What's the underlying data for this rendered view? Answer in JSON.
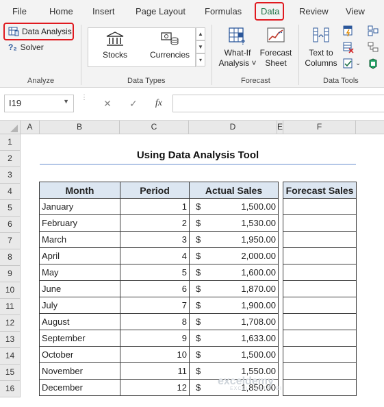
{
  "tabs": [
    "File",
    "Home",
    "Insert",
    "Page Layout",
    "Formulas",
    "Data",
    "Review",
    "View"
  ],
  "active_tab": "Data",
  "highlight_color": "#e0191f",
  "ribbon": {
    "analyze": {
      "data_analysis": "Data Analysis",
      "solver": "Solver",
      "label": "Analyze"
    },
    "data_types": {
      "stocks": "Stocks",
      "currencies": "Currencies",
      "label": "Data Types"
    },
    "forecast": {
      "what_if_1": "What-If",
      "what_if_2": "Analysis ˅",
      "sheet_1": "Forecast",
      "sheet_2": "Sheet",
      "label": "Forecast"
    },
    "data_tools": {
      "ttc_1": "Text to",
      "ttc_2": "Columns",
      "label": "Data Tools"
    }
  },
  "formula_bar": {
    "name_box": "I19",
    "cancel": "✕",
    "enter": "✓",
    "fx": "fx",
    "value": ""
  },
  "columns": [
    "A",
    "B",
    "C",
    "D",
    "E",
    "F"
  ],
  "rows": [
    "1",
    "2",
    "3",
    "4",
    "5",
    "6",
    "7",
    "8",
    "9",
    "10",
    "11",
    "12",
    "13",
    "14",
    "15",
    "16"
  ],
  "title": "Using Data Analysis Tool",
  "table": {
    "headers": [
      "Month",
      "Period",
      "Actual Sales"
    ],
    "rows": [
      {
        "month": "January",
        "period": "1",
        "sales": "1,500.00"
      },
      {
        "month": "February",
        "period": "2",
        "sales": "1,530.00"
      },
      {
        "month": "March",
        "period": "3",
        "sales": "1,950.00"
      },
      {
        "month": "April",
        "period": "4",
        "sales": "2,000.00"
      },
      {
        "month": "May",
        "period": "5",
        "sales": "1,600.00"
      },
      {
        "month": "June",
        "period": "6",
        "sales": "1,870.00"
      },
      {
        "month": "July",
        "period": "7",
        "sales": "1,900.00"
      },
      {
        "month": "August",
        "period": "8",
        "sales": "1,708.00"
      },
      {
        "month": "September",
        "period": "9",
        "sales": "1,633.00"
      },
      {
        "month": "October",
        "period": "10",
        "sales": "1,500.00"
      },
      {
        "month": "November",
        "period": "11",
        "sales": "1,550.00"
      },
      {
        "month": "December",
        "period": "12",
        "sales": "1,850.00"
      }
    ],
    "currency": "$"
  },
  "forecast_table": {
    "header": "Forecast Sales",
    "rows": 12
  },
  "watermark": {
    "brand": "exceldemy",
    "tagline": "EXCEL · DATA · BI"
  }
}
